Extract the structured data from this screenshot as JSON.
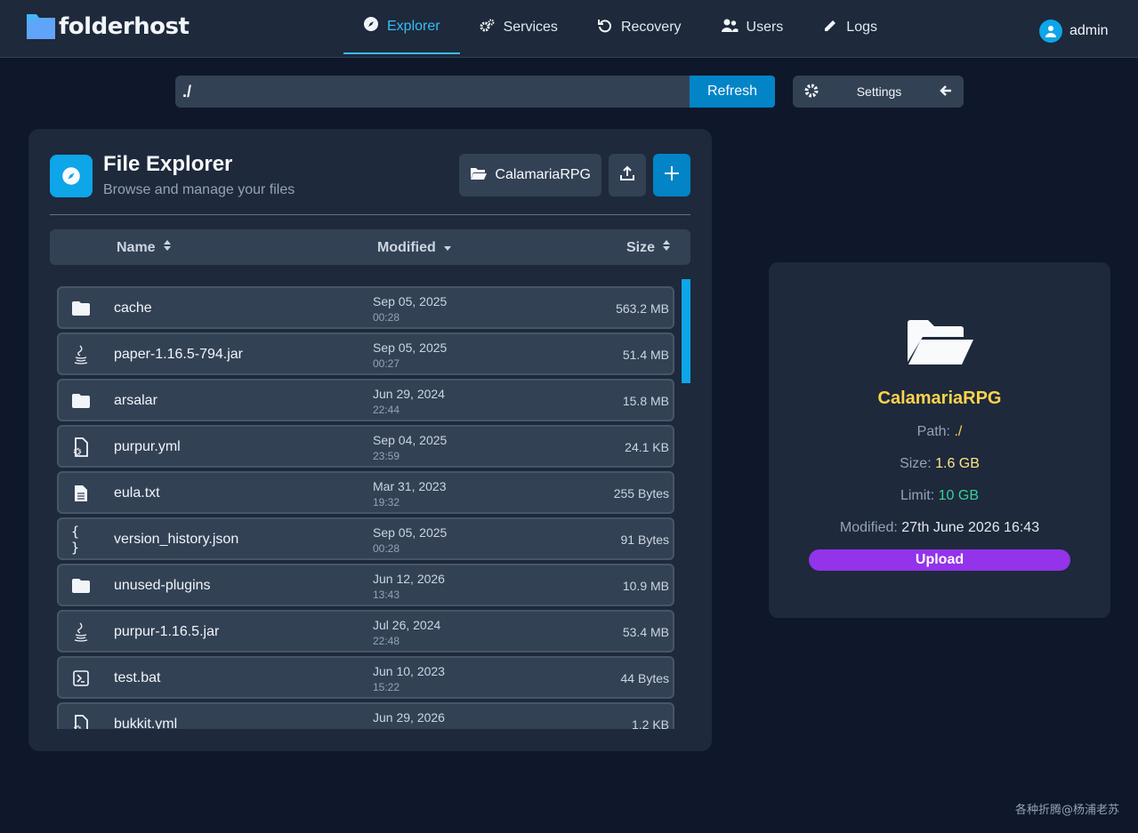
{
  "app": {
    "logo_text": "folderhost"
  },
  "nav": {
    "items": [
      {
        "label": "Explorer",
        "icon": "compass-icon"
      },
      {
        "label": "Services",
        "icon": "gears-icon"
      },
      {
        "label": "Recovery",
        "icon": "rotate-left-icon"
      },
      {
        "label": "Users",
        "icon": "users-icon"
      },
      {
        "label": "Logs",
        "icon": "pencil-icon"
      }
    ],
    "active": "Explorer"
  },
  "user": {
    "name": "admin"
  },
  "pathbar": {
    "value": "./",
    "refresh_label": "Refresh"
  },
  "settings": {
    "label": "Settings"
  },
  "explorer": {
    "title": "File Explorer",
    "subtitle": "Browse and manage your files",
    "folder_button": "CalamariaRPG",
    "columns": {
      "name": "Name",
      "modified": "Modified",
      "size": "Size"
    },
    "rows": [
      {
        "icon": "folder-icon",
        "name": "cache",
        "date": "Sep 05, 2025",
        "time": "00:28",
        "size": "563.2 MB"
      },
      {
        "icon": "java-icon",
        "name": "paper-1.16.5-794.jar",
        "date": "Sep 05, 2025",
        "time": "00:27",
        "size": "51.4 MB"
      },
      {
        "icon": "folder-icon",
        "name": "arsalar",
        "date": "Jun 29, 2024",
        "time": "22:44",
        "size": "15.8 MB"
      },
      {
        "icon": "config-file-icon",
        "name": "purpur.yml",
        "date": "Sep 04, 2025",
        "time": "23:59",
        "size": "24.1 KB"
      },
      {
        "icon": "text-file-icon",
        "name": "eula.txt",
        "date": "Mar 31, 2023",
        "time": "19:32",
        "size": "255 Bytes"
      },
      {
        "icon": "json-icon",
        "name": "version_history.json",
        "date": "Sep 05, 2025",
        "time": "00:28",
        "size": "91 Bytes"
      },
      {
        "icon": "folder-icon",
        "name": "unused-plugins",
        "date": "Jun 12, 2026",
        "time": "13:43",
        "size": "10.9 MB"
      },
      {
        "icon": "java-icon",
        "name": "purpur-1.16.5.jar",
        "date": "Jul 26, 2024",
        "time": "22:48",
        "size": "53.4 MB"
      },
      {
        "icon": "terminal-icon",
        "name": "test.bat",
        "date": "Jun 10, 2023",
        "time": "15:22",
        "size": "44 Bytes"
      },
      {
        "icon": "config-file-icon",
        "name": "bukkit.yml",
        "date": "Jun 29, 2026",
        "time": "",
        "size": "1.2 KB"
      }
    ]
  },
  "info": {
    "name": "CalamariaRPG",
    "path_label": "Path:",
    "path_value": "./",
    "size_label": "Size:",
    "size_value": "1.6 GB",
    "limit_label": "Limit:",
    "limit_value": "10 GB",
    "modified_label": "Modified:",
    "modified_value": "27th June 2026 16:43",
    "upload_label": "Upload"
  },
  "footer": {
    "text": "各种折腾@杨浦老苏"
  },
  "colors": {
    "accent": "#0ea5e9",
    "upload": "#9333ea",
    "highlight": "#fcd34d",
    "limit": "#34d399"
  }
}
